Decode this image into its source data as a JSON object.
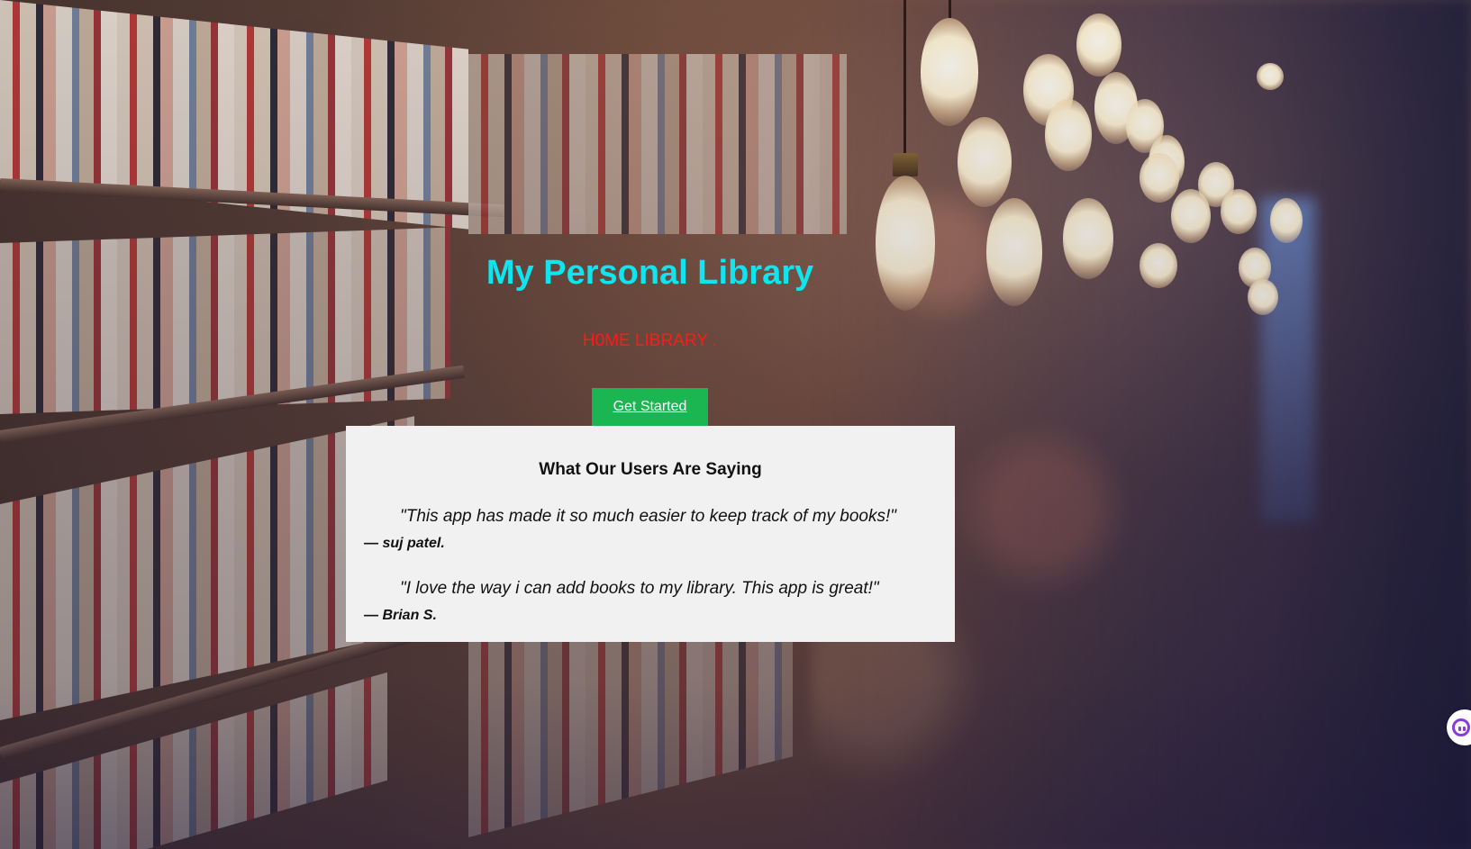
{
  "hero": {
    "title": "My Personal Library",
    "subtitle": "H0ME LIBRARY .",
    "cta_label": "Get Started"
  },
  "testimonials": {
    "heading": "What Our Users Are Saying",
    "items": [
      {
        "quote": "\"This app has made it so much easier to keep track of my books!\"",
        "author": "— suj patel."
      },
      {
        "quote": "\"I love the way i can add books to my library. This app is great!\"",
        "author": "— Brian S."
      }
    ]
  },
  "colors": {
    "title": "#10e4ee",
    "subtitle": "#ff1a1a",
    "cta_background": "#1bb551",
    "card_background": "#f1f1f1"
  },
  "icons": {
    "chat_widget": "chatbot-face-icon"
  }
}
